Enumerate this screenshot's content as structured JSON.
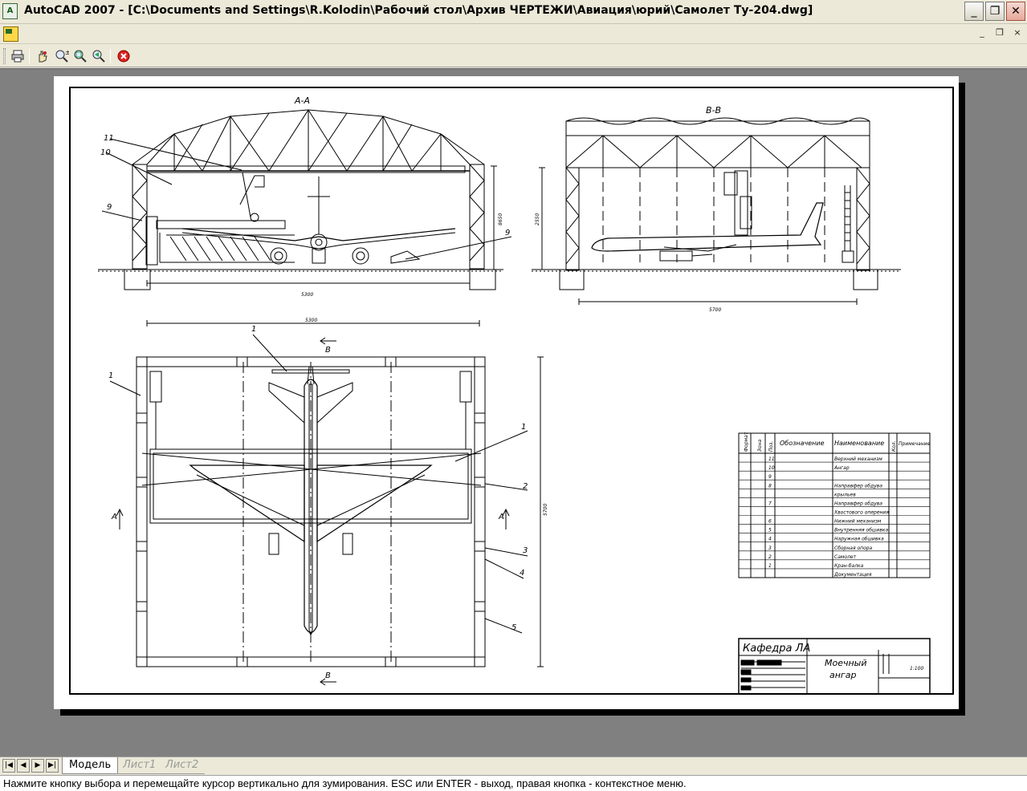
{
  "window": {
    "app_icon_label": "A",
    "title": "AutoCAD 2007 - [C:\\Documents and Settings\\R.Kolodin\\Рабочий стол\\Архив ЧЕРТЕЖИ\\Авиация\\юрий\\Самолет Ту-204.dwg]",
    "minimize_glyph": "_",
    "maximize_glyph": "❐",
    "close_glyph": "✕",
    "doc_minimize_glyph": "_",
    "doc_restore_glyph": "❐",
    "doc_close_glyph": "×"
  },
  "toolbar": {
    "icons": [
      "print-icon",
      "pan-icon",
      "zoom-realtime-icon",
      "zoom-window-icon",
      "zoom-previous-icon",
      "close-preview-icon"
    ]
  },
  "drawing": {
    "section_aa_title": "А-А",
    "section_bb_title": "В-В",
    "callouts_aa": [
      "11",
      "10",
      "9",
      "9"
    ],
    "dim_aa_width": "5300",
    "dim_aa_height": "8650",
    "dim_bb_height": "2550",
    "dim_bb_width": "5700",
    "dim_plan_width": "5300",
    "dim_plan_height": "5700",
    "plan_callouts": [
      "1",
      "1",
      "1",
      "2",
      "3",
      "4",
      "5"
    ],
    "section_mark_a": "A",
    "section_mark_b": "B",
    "bom_headers": [
      "Формат",
      "Зона",
      "Поз.",
      "Обозначение",
      "Наименование",
      "Кол.",
      "Примечание"
    ],
    "bom_rows": [
      {
        "pos": "11",
        "name": "Верхний механизм"
      },
      {
        "pos": "10",
        "name": "Ангар"
      },
      {
        "pos": "9",
        "name": ""
      },
      {
        "pos": "8",
        "name": "Направфер обдува"
      },
      {
        "pos": "",
        "name": "крыльев"
      },
      {
        "pos": "7",
        "name": "Направфер обдува"
      },
      {
        "pos": "",
        "name": "Хвостового оперения"
      },
      {
        "pos": "6",
        "name": "Нижний механизм"
      },
      {
        "pos": "5",
        "name": "Внутренняя обшивка"
      },
      {
        "pos": "4",
        "name": "Наружная обшивка"
      },
      {
        "pos": "3",
        "name": "Сборная опора"
      },
      {
        "pos": "2",
        "name": "Самолет"
      },
      {
        "pos": "1",
        "name": "Кран-балка"
      },
      {
        "pos": "",
        "name": "Документация"
      }
    ],
    "title_block_dept": "Кафедра ЛА",
    "title_block_name_line1": "Моечный",
    "title_block_name_line2": "ангар",
    "title_block_scale": "1:100"
  },
  "tabs": {
    "model": "Модель",
    "layout1": "Лист1",
    "layout2": "Лист2",
    "nav": [
      "|◀",
      "◀",
      "▶",
      "▶|"
    ]
  },
  "status": {
    "command_prompt": "Нажмите кнопку выбора и перемещайте курсор вертикально для зумирования. ESC или ENTER - выход, правая кнопка - контекстное меню."
  },
  "colors": {
    "canvas": "#808080",
    "sheet": "#ffffff",
    "ink": "#000000"
  }
}
